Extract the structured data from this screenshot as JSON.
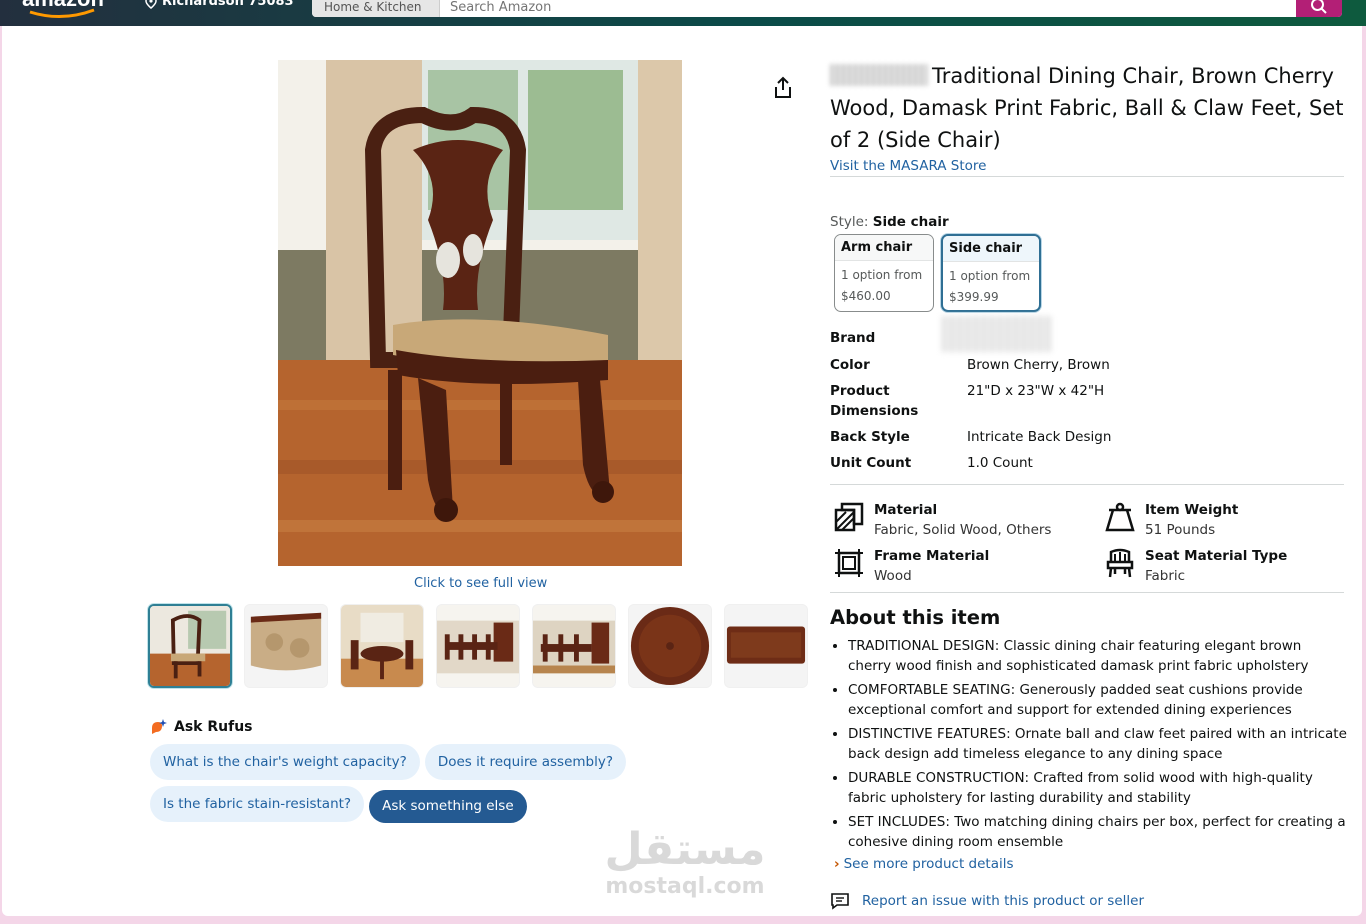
{
  "header": {
    "location": "Richardson 75083",
    "search_dept": "Home & Kitchen",
    "search_placeholder": "Search Amazon"
  },
  "gallery": {
    "full_view_link": "Click to see full view",
    "thumbnail_count": 7
  },
  "rufus": {
    "title": "Ask Rufus",
    "chips": [
      "What is the chair's weight capacity?",
      "Does it require assembly?",
      "Is the fabric stain-resistant?"
    ],
    "ask_else": "Ask something else"
  },
  "product": {
    "title": "Traditional Dining Chair, Brown Cherry Wood, Damask Print Fabric, Ball & Claw Feet, Set of 2 (Side Chair)",
    "store_link": "Visit the MASARA Store",
    "style_label": "Style:",
    "style_value": "Side chair",
    "options": [
      {
        "name": "Arm chair",
        "line1": "1 option from",
        "price": "$460.00"
      },
      {
        "name": "Side chair",
        "line1": "1 option from",
        "price": "$399.99"
      }
    ],
    "specs": [
      {
        "key": "Brand",
        "value": ""
      },
      {
        "key": "Color",
        "value": "Brown Cherry, Brown"
      },
      {
        "key": "Product Dimensions",
        "value": "21\"D x 23\"W x 42\"H"
      },
      {
        "key": "Back Style",
        "value": "Intricate Back Design"
      },
      {
        "key": "Unit Count",
        "value": "1.0 Count"
      }
    ],
    "features": [
      {
        "key": "Material",
        "value": "Fabric, Solid Wood, Others",
        "icon": "material-icon"
      },
      {
        "key": "Item Weight",
        "value": "51 Pounds",
        "icon": "weight-icon"
      },
      {
        "key": "Frame Material",
        "value": "Wood",
        "icon": "frame-icon"
      },
      {
        "key": "Seat Material Type",
        "value": "Fabric",
        "icon": "seat-icon"
      }
    ]
  },
  "about": {
    "heading": "About this item",
    "bullets": [
      "TRADITIONAL DESIGN: Classic dining chair featuring elegant brown cherry wood finish and sophisticated damask print fabric upholstery",
      "COMFORTABLE SEATING: Generously padded seat cushions provide exceptional comfort and support for extended dining experiences",
      "DISTINCTIVE FEATURES: Ornate ball and claw feet paired with an intricate back design add timeless elegance to any dining space",
      "DURABLE CONSTRUCTION: Crafted from solid wood with high-quality fabric upholstery for lasting durability and stability",
      "SET INCLUDES: Two matching dining chairs per box, perfect for creating a cohesive dining room ensemble"
    ],
    "see_more": "See more product details",
    "report": "Report an issue with this product or seller"
  },
  "watermark": {
    "arabic": "مستقل",
    "latin": "mostaql.com"
  },
  "colors": {
    "link": "#2162a1",
    "accent": "#2f6f94",
    "search_button": "#b31f76"
  }
}
